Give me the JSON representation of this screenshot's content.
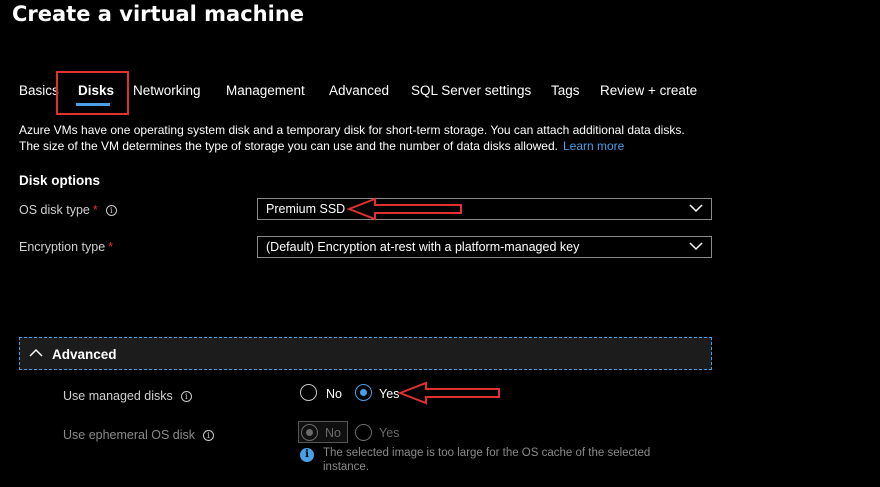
{
  "page": {
    "title": "Create a virtual machine"
  },
  "tabs": [
    {
      "label": "Basics",
      "active": false
    },
    {
      "label": "Disks",
      "active": true
    },
    {
      "label": "Networking",
      "active": false
    },
    {
      "label": "Management",
      "active": false
    },
    {
      "label": "Advanced",
      "active": false
    },
    {
      "label": "SQL Server settings",
      "active": false
    },
    {
      "label": "Tags",
      "active": false
    },
    {
      "label": "Review + create",
      "active": false
    }
  ],
  "description": {
    "line1": "Azure VMs have one operating system disk and a temporary disk for short-term storage. You can attach additional data disks.",
    "line2": "The size of the VM determines the type of storage you can use and the number of data disks allowed.",
    "learn_more": "Learn more"
  },
  "disk_options": {
    "heading": "Disk options",
    "os_disk_type": {
      "label": "OS disk type",
      "required_mark": "*",
      "value": "Premium SSD"
    },
    "encryption_type": {
      "label": "Encryption type",
      "required_mark": "*",
      "value": "(Default) Encryption at-rest with a platform-managed key"
    }
  },
  "advanced": {
    "heading": "Advanced",
    "managed_disks": {
      "label": "Use managed disks",
      "options": [
        "No",
        "Yes"
      ],
      "selected": "Yes"
    },
    "ephemeral_os_disk": {
      "label": "Use ephemeral OS disk",
      "options": [
        "No",
        "Yes"
      ],
      "selected": "No",
      "disabled": true,
      "info": "The selected image is too large for the OS cache of the selected instance."
    }
  },
  "colors": {
    "accent": "#4aa0e6",
    "annotation": "#e03030",
    "background": "#000000"
  },
  "icons": {
    "info": "info-icon",
    "chevron": "chevron-down-icon",
    "collapse": "chevron-up-icon"
  }
}
